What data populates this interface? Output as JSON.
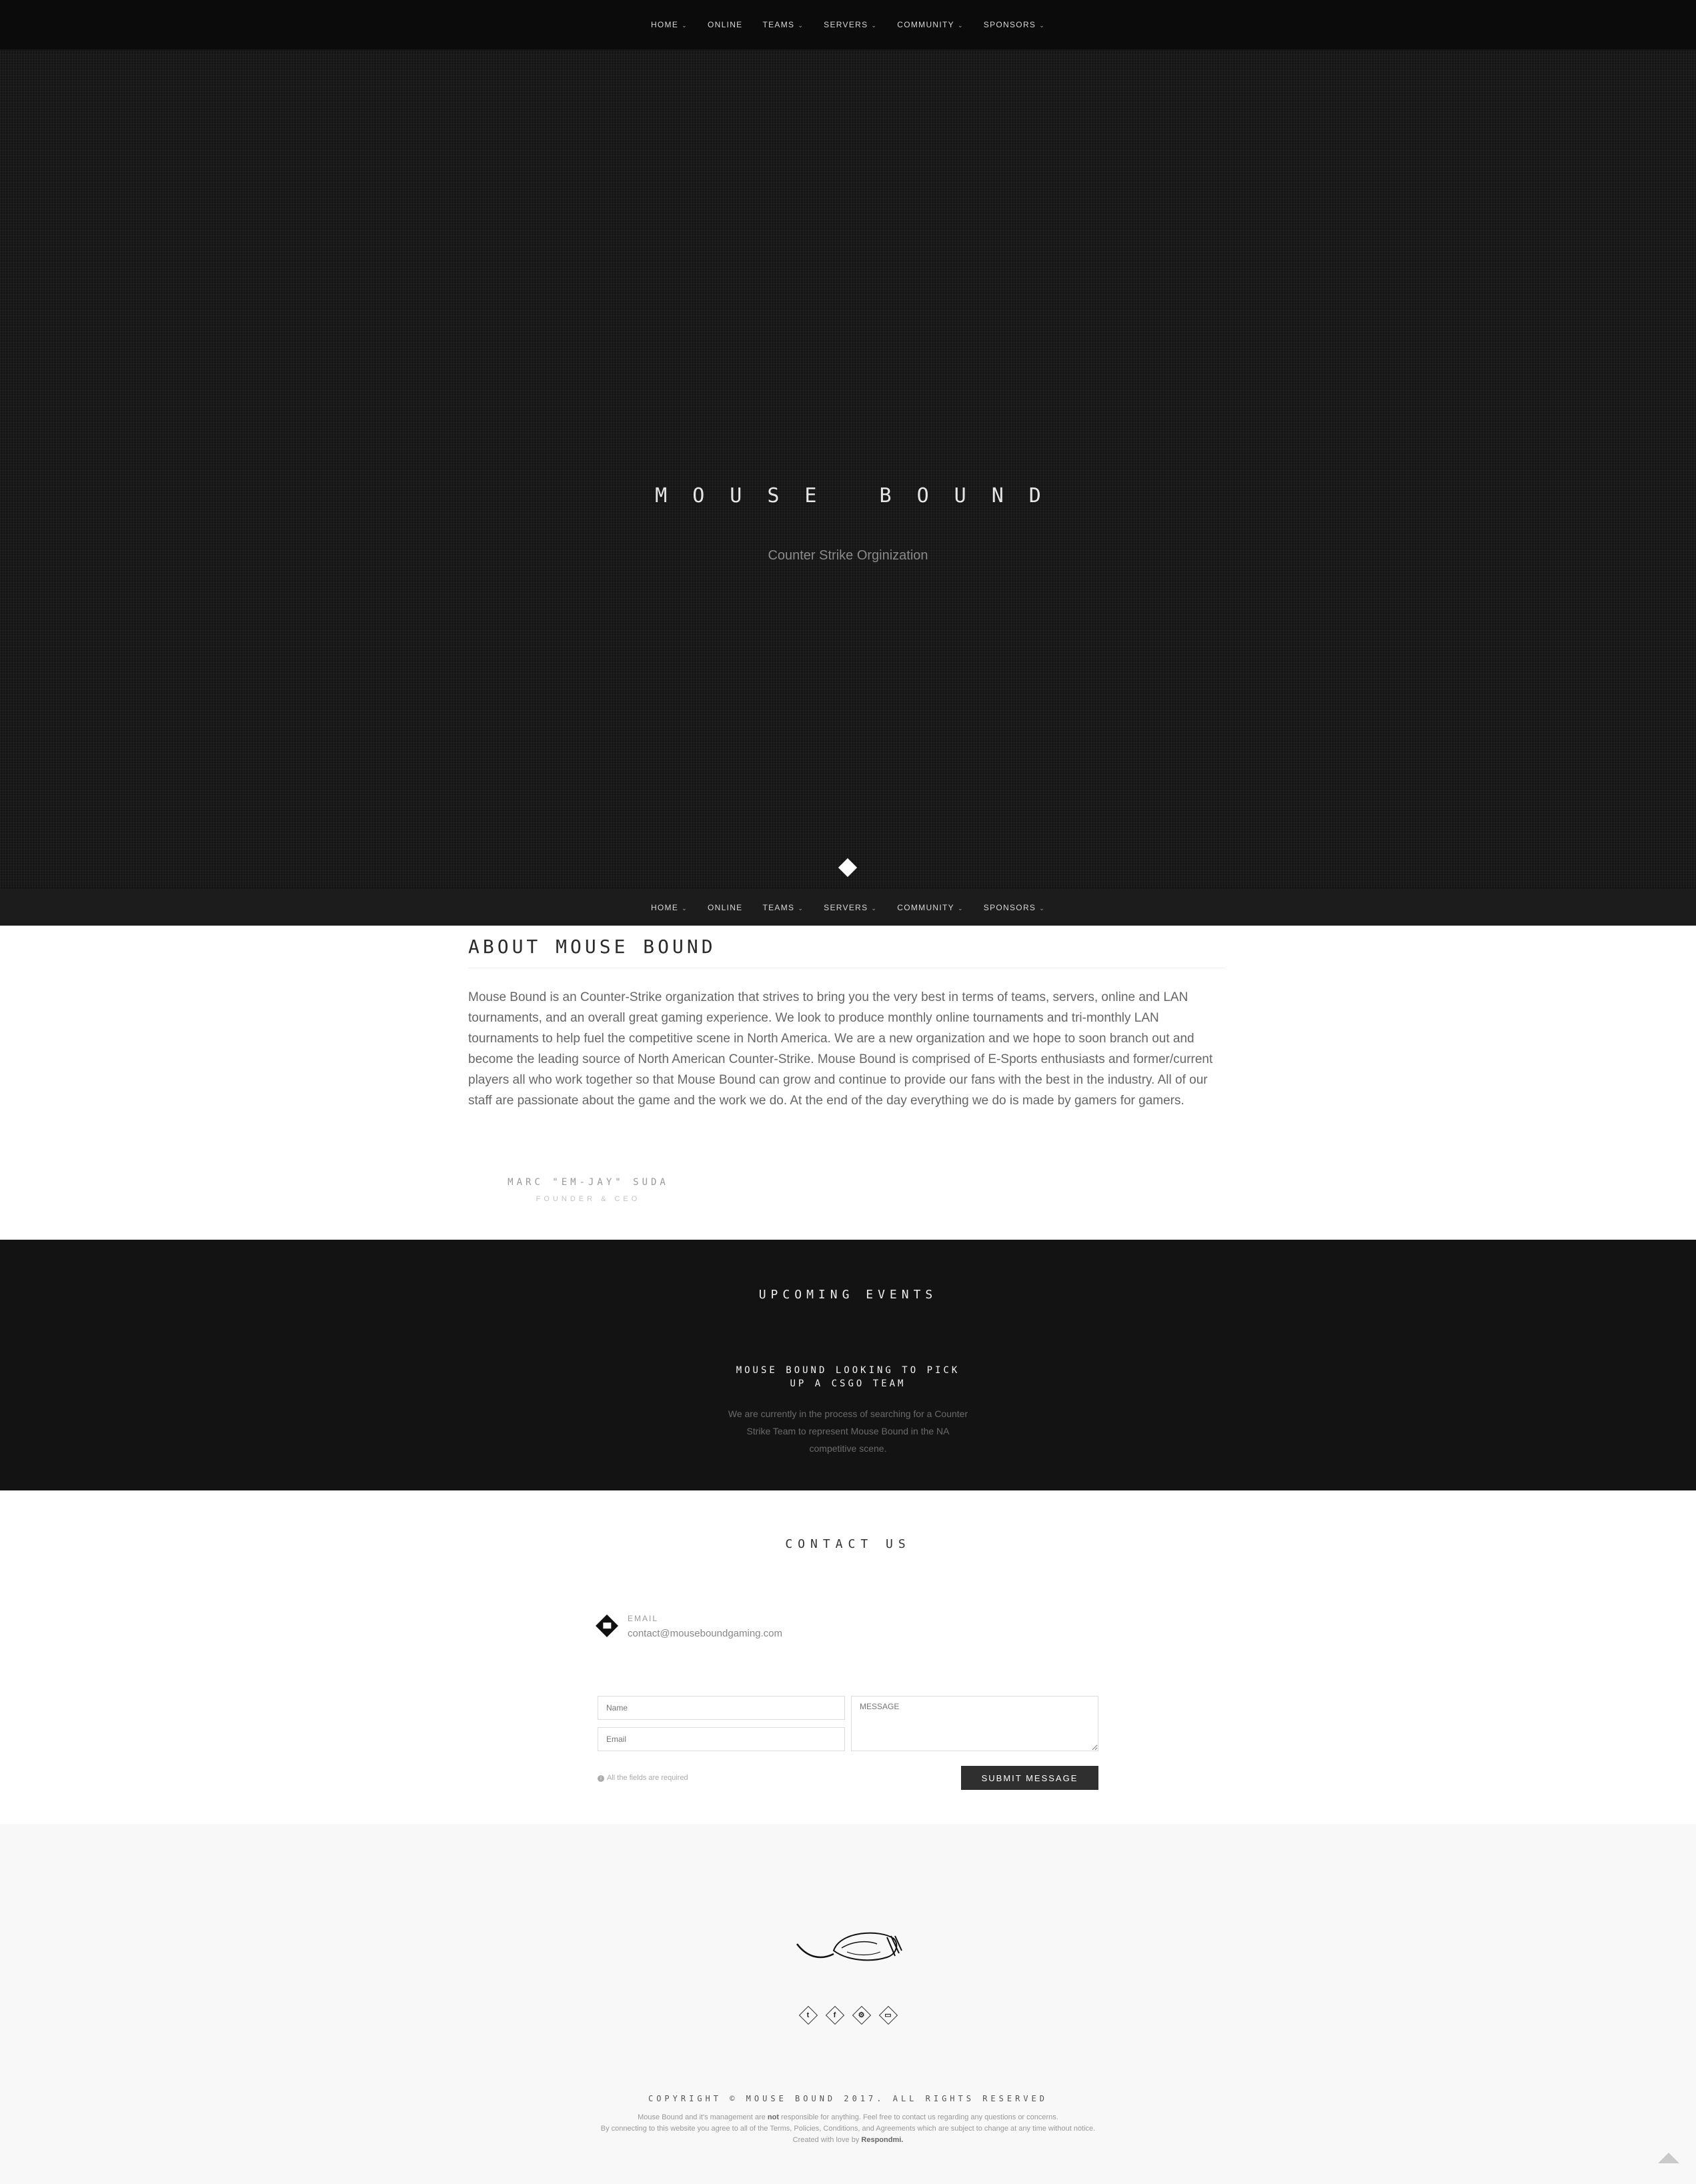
{
  "nav": {
    "items": [
      {
        "label": "HOME",
        "dropdown": true
      },
      {
        "label": "ONLINE",
        "dropdown": false
      },
      {
        "label": "TEAMS",
        "dropdown": true
      },
      {
        "label": "SERVERS",
        "dropdown": true
      },
      {
        "label": "COMMUNITY",
        "dropdown": true
      },
      {
        "label": "SPONSORS",
        "dropdown": true
      }
    ]
  },
  "hero": {
    "title": "MOUSE BOUND",
    "subtitle": "Counter Strike Orginization"
  },
  "about": {
    "heading": "ABOUT MOUSE BOUND",
    "text": "Mouse Bound is an Counter-Strike organization that strives to bring you the very best in terms of teams, servers, online and LAN tournaments, and an overall great gaming experience. We look to produce monthly online tournaments and tri-monthly LAN tournaments to help fuel the competitive scene in North America. We are a new organization and we hope to soon branch out and become the leading source of North American Counter-Strike. Mouse Bound is comprised of E-Sports enthusiasts and former/current players all who work together so that Mouse Bound can grow and continue to provide our fans with the best in the industry. All of our staff are passionate about the game and the work we do. At the end of the day everything we do is made by gamers for gamers.",
    "founder_name": "MARC \"EM-JAY\" SUDA",
    "founder_title": "FOUNDER & CEO"
  },
  "events": {
    "heading": "UPCOMING EVENTS",
    "title": "MOUSE BOUND LOOKING TO PICK UP A CSGO TEAM",
    "description": "We are currently in the process of searching for a Counter Strike Team to represent Mouse Bound in the NA competitive scene."
  },
  "contact": {
    "heading": "CONTACT US",
    "email_label": "EMAIL",
    "email_value": "contact@mouseboundgaming.com",
    "name_placeholder": "Name",
    "email_placeholder": "Email",
    "message_placeholder": "MESSAGE",
    "required_note": "All the fields are required",
    "submit_label": "SUBMIT MESSAGE"
  },
  "footer": {
    "socials": [
      "twitter-icon",
      "facebook-icon",
      "steam-icon",
      "twitch-icon"
    ],
    "copyright": "COPYRIGHT © MOUSE BOUND 2017. ALL RIGHTS RESERVED",
    "disclaimer_1a": "Mouse Bound and it's management are",
    "disclaimer_1b": "not",
    "disclaimer_1c": "responsible for anything. Feel free to contact us regarding any questions or concerns.",
    "disclaimer_2": "By connecting to this website you agree to all of the Terms, Policies, Conditions, and Agreements which are subject to change at any time without notice.",
    "disclaimer_3a": "Created with love by",
    "disclaimer_3b": "Respondmi."
  },
  "colors": {
    "nav_bg": "#0b0b0b",
    "hero_bg": "#151515",
    "events_bg": "#131313",
    "footer_bg": "#f8f8f8",
    "button_bg": "#2f2f2f"
  }
}
